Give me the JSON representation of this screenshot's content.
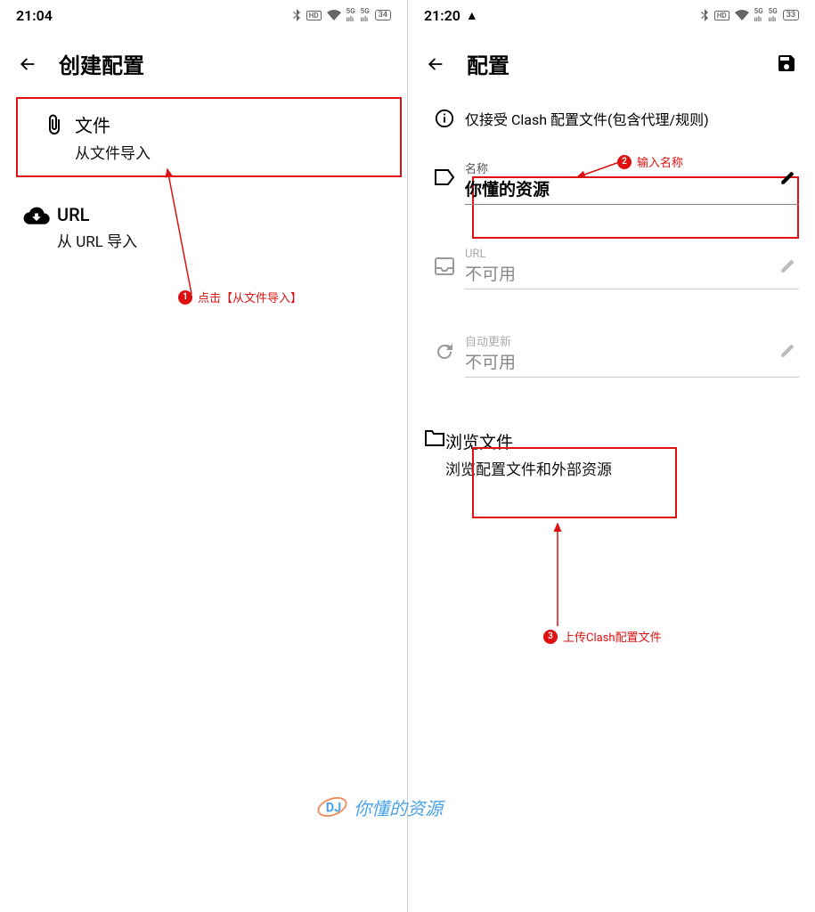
{
  "left": {
    "status": {
      "time": "21:04",
      "battery": "34"
    },
    "appbar": {
      "title": "创建配置"
    },
    "items": [
      {
        "title": "文件",
        "subtitle": "从文件导入"
      },
      {
        "title": "URL",
        "subtitle": "从 URL 导入"
      }
    ],
    "annotation1": {
      "num": "1",
      "text": "点击【从文件导入】"
    }
  },
  "right": {
    "status": {
      "time": "21:20",
      "battery": "33"
    },
    "appbar": {
      "title": "配置"
    },
    "info": "仅接受 Clash 配置文件(包含代理/规则)",
    "nameField": {
      "label": "名称",
      "value": "你懂的资源"
    },
    "urlField": {
      "label": "URL",
      "value": "不可用"
    },
    "autoField": {
      "label": "自动更新",
      "value": "不可用"
    },
    "browse": {
      "title": "浏览文件",
      "subtitle": "浏览配置文件和外部资源"
    },
    "annotation2": {
      "num": "2",
      "text": "输入名称"
    },
    "annotation3": {
      "num": "3",
      "text": "上传Clash配置文件"
    }
  },
  "watermark": "你懂的资源"
}
